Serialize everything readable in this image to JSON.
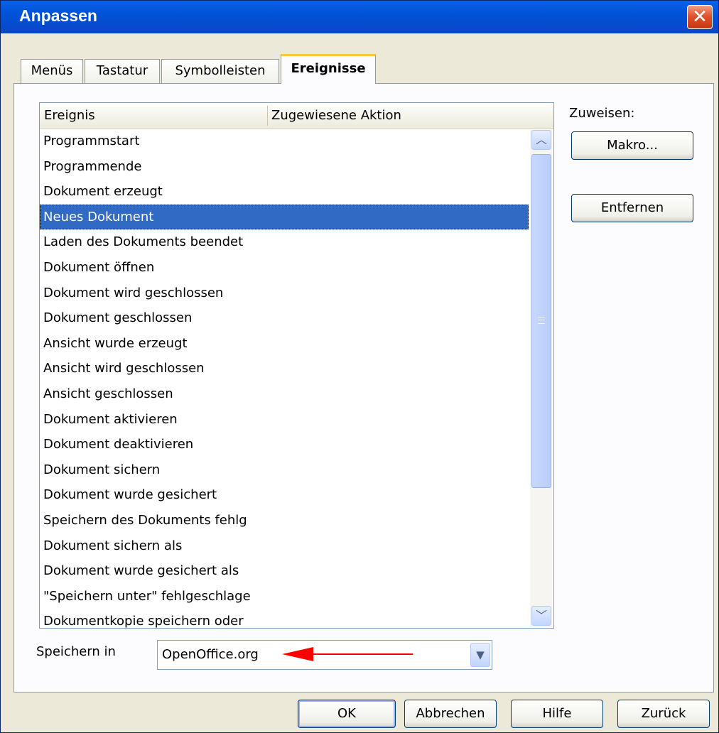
{
  "window": {
    "title": "Anpassen",
    "close_glyph": "✕"
  },
  "tabs": [
    {
      "label": "Menüs"
    },
    {
      "label": "Tastatur"
    },
    {
      "label": "Symbolleisten"
    },
    {
      "label": "Ereignisse",
      "active": true
    }
  ],
  "events_list": {
    "columns": [
      "Ereignis",
      "Zugewiesene Aktion"
    ],
    "rows": [
      "Programmstart",
      "Programmende",
      "Dokument erzeugt",
      "Neues Dokument",
      "Laden des Dokuments beendet",
      "Dokument öffnen",
      "Dokument wird geschlossen",
      "Dokument geschlossen",
      "Ansicht wurde erzeugt",
      "Ansicht wird geschlossen",
      "Ansicht geschlossen",
      "Dokument aktivieren",
      "Dokument deaktivieren",
      "Dokument sichern",
      "Dokument wurde gesichert",
      "Speichern des Dokuments fehlg",
      "Dokument sichern als",
      "Dokument wurde gesichert als",
      "\"Speichern unter\" fehlgeschlage",
      "Dokumentkopie speichern oder"
    ],
    "selected_row": "Neues Dokument"
  },
  "assign": {
    "label": "Zuweisen:",
    "macro_button": "Makro...",
    "remove_button": "Entfernen"
  },
  "save_in": {
    "label": "Speichern in",
    "value": "OpenOffice.org"
  },
  "footer": {
    "ok": "OK",
    "cancel": "Abbrechen",
    "help": "Hilfe",
    "reset": "Zurück"
  },
  "colors": {
    "selection": "#316ac5",
    "annotation_arrow": "#ff0000",
    "titlebar": "#0054e3"
  }
}
